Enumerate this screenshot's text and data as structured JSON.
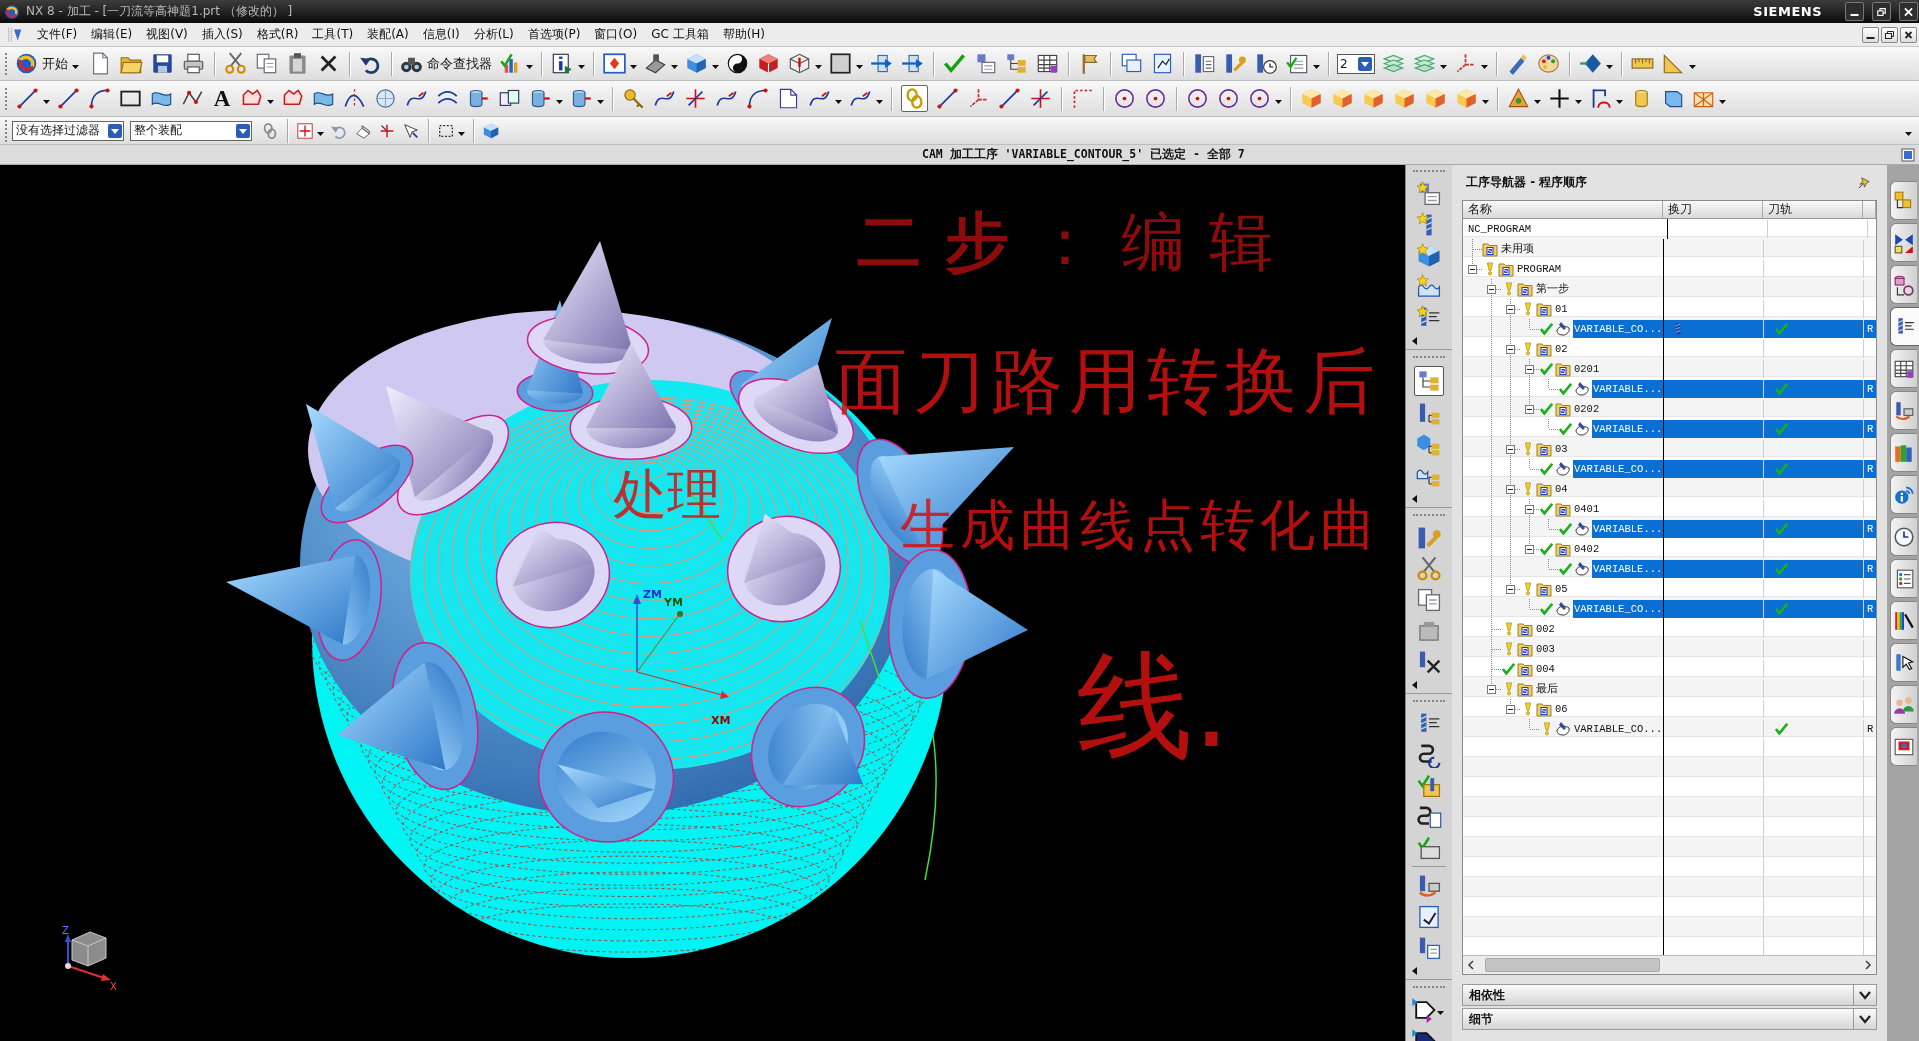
{
  "window": {
    "title": "NX 8 - 加工 - [一刀流等高神题1.prt （修改的） ]",
    "brand": "SIEMENS"
  },
  "menu": [
    "文件(F)",
    "编辑(E)",
    "视图(V)",
    "插入(S)",
    "格式(R)",
    "工具(T)",
    "装配(A)",
    "信息(I)",
    "分析(L)",
    "首选项(P)",
    "窗口(O)",
    "GC 工具箱",
    "帮助(H)"
  ],
  "standard_toolbar": {
    "start_label": "开始",
    "finder_label": "命令查找器",
    "layer": "2"
  },
  "curve_toolbar": {
    "text_tool": "A",
    "chain_snap_on": true
  },
  "selection_bar": {
    "filter": "没有选择过滤器",
    "scope": "整个装配"
  },
  "status_line": "CAM 加工工序 'VARIABLE_CONTOUR_5' 已选定 - 全部 7",
  "viewport": {
    "csys_labels": [
      "ZM",
      "YM",
      "XM"
    ],
    "triad_labels": [
      "Z",
      "X"
    ]
  },
  "annotation": {
    "heading": "**二步**：编辑",
    "lines": [
      "面刀路用转换后",
      "生成曲线点转化曲",
      "线."
    ],
    "side_note": "处理"
  },
  "navigator": {
    "title": "工序导航器 - 程序顺序",
    "program_order_view_on": true,
    "columns": [
      "名称",
      "换刀",
      "刀轨"
    ],
    "tree": [
      {
        "name": "NC_PROGRAM",
        "selected": false,
        "children": [
          {
            "name": "未用项",
            "kind": "group",
            "selected": false
          },
          {
            "name": "PROGRAM",
            "kind": "group",
            "complete": false,
            "selected": false,
            "expanded": true,
            "children": [
              {
                "name": "第一步",
                "kind": "group",
                "complete": false,
                "selected": false,
                "expanded": true,
                "children": [
                  {
                    "name": "01",
                    "kind": "group",
                    "complete": false,
                    "selected": false,
                    "expanded": true,
                    "children": [
                      {
                        "name": "VARIABLE_CO...",
                        "kind": "operation",
                        "complete": true,
                        "selected": true,
                        "tool_change": true,
                        "toolpath_ok": true,
                        "column_4": "R"
                      }
                    ]
                  },
                  {
                    "name": "02",
                    "kind": "group",
                    "complete": false,
                    "selected": false,
                    "expanded": true,
                    "children": [
                      {
                        "name": "0201",
                        "kind": "group",
                        "complete": true,
                        "selected": false,
                        "expanded": true,
                        "children": [
                          {
                            "name": "VARIABLE...",
                            "kind": "operation",
                            "complete": true,
                            "selected": true,
                            "tool_change": false,
                            "toolpath_ok": true,
                            "column_4": "R"
                          }
                        ]
                      },
                      {
                        "name": "0202",
                        "kind": "group",
                        "complete": true,
                        "selected": false,
                        "expanded": true,
                        "children": [
                          {
                            "name": "VARIABLE...",
                            "kind": "operation",
                            "complete": true,
                            "selected": true,
                            "tool_change": false,
                            "toolpath_ok": true,
                            "column_4": "R"
                          }
                        ]
                      }
                    ]
                  },
                  {
                    "name": "03",
                    "kind": "group",
                    "complete": false,
                    "selected": false,
                    "expanded": true,
                    "children": [
                      {
                        "name": "VARIABLE_CO...",
                        "kind": "operation",
                        "complete": true,
                        "selected": true,
                        "tool_change": false,
                        "toolpath_ok": true,
                        "column_4": "R"
                      }
                    ]
                  },
                  {
                    "name": "04",
                    "kind": "group",
                    "complete": false,
                    "selected": false,
                    "expanded": true,
                    "children": [
                      {
                        "name": "0401",
                        "kind": "group",
                        "complete": true,
                        "selected": false,
                        "expanded": true,
                        "children": [
                          {
                            "name": "VARIABLE...",
                            "kind": "operation",
                            "complete": true,
                            "selected": true,
                            "tool_change": false,
                            "toolpath_ok": true,
                            "column_4": "R"
                          }
                        ]
                      },
                      {
                        "name": "0402",
                        "kind": "group",
                        "complete": true,
                        "selected": false,
                        "expanded": true,
                        "children": [
                          {
                            "name": "VARIABLE...",
                            "kind": "operation",
                            "complete": true,
                            "selected": true,
                            "tool_change": false,
                            "toolpath_ok": true,
                            "column_4": "R"
                          }
                        ]
                      }
                    ]
                  },
                  {
                    "name": "05",
                    "kind": "group",
                    "complete": false,
                    "selected": false,
                    "expanded": true,
                    "children": [
                      {
                        "name": "VARIABLE_CO...",
                        "kind": "operation",
                        "complete": true,
                        "selected": true,
                        "tool_change": false,
                        "toolpath_ok": true,
                        "column_4": "R"
                      }
                    ]
                  }
                ]
              },
              {
                "name": "002",
                "kind": "group",
                "complete": false,
                "selected": false
              },
              {
                "name": "003",
                "kind": "group",
                "complete": false,
                "selected": false
              },
              {
                "name": "004",
                "kind": "group",
                "complete": true,
                "selected": false
              },
              {
                "name": "最后",
                "kind": "group",
                "complete": false,
                "selected": false,
                "expanded": true,
                "children": [
                  {
                    "name": "06",
                    "kind": "group",
                    "complete": false,
                    "selected": false,
                    "expanded": true,
                    "children": [
                      {
                        "name": "VARIABLE_CO...",
                        "kind": "operation",
                        "complete": false,
                        "selected": false,
                        "tool_change": false,
                        "toolpath_ok": true,
                        "column_4": "R"
                      }
                    ]
                  }
                ]
              }
            ]
          }
        ]
      }
    ],
    "panels": [
      {
        "label": "相依性",
        "expanded": false
      },
      {
        "label": "细节",
        "expanded": false
      }
    ]
  },
  "resource_bar": {
    "tabs": [
      {
        "selected": false
      },
      {
        "selected": false
      },
      {
        "selected": false
      },
      {
        "selected": true
      },
      {
        "selected": false
      },
      {
        "selected": false
      },
      {
        "selected": false
      },
      {
        "selected": false
      },
      {
        "selected": false
      },
      {
        "selected": false
      },
      {
        "selected": false
      },
      {
        "selected": false
      },
      {
        "selected": false
      },
      {
        "selected": false
      }
    ]
  }
}
